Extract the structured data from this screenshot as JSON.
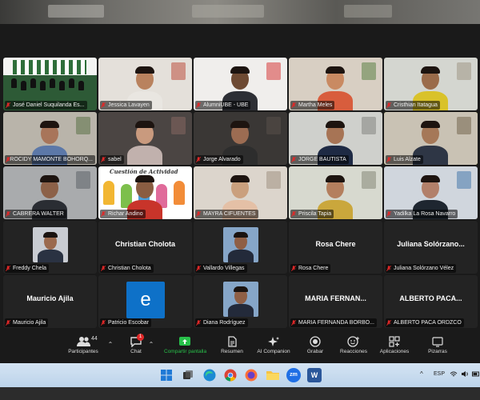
{
  "participants": [
    {
      "name": "José Daniel Suquilanda Es...",
      "type": "video",
      "active": false
    },
    {
      "name": "Jessica Lavayen",
      "type": "video",
      "active": false
    },
    {
      "name": "AlumniUBE - UBE",
      "type": "video",
      "active": false
    },
    {
      "name": "Martha Meles",
      "type": "video",
      "active": false
    },
    {
      "name": "Cristhian Itatagua",
      "type": "video",
      "active": false
    },
    {
      "name": "ROCIDY MAMONTE BOHORQ...",
      "type": "video",
      "active": false
    },
    {
      "name": "sabel",
      "type": "video",
      "active": false
    },
    {
      "name": "Jorge Alvarado",
      "type": "video",
      "active": false
    },
    {
      "name": "JORGE BAUTISTA",
      "type": "video",
      "active": false
    },
    {
      "name": "Luis Alzate",
      "type": "video",
      "active": true
    },
    {
      "name": "CABRERA WALTER",
      "type": "video",
      "active": false
    },
    {
      "name": "Richar Andino",
      "type": "video",
      "active": false
    },
    {
      "name": "MAYRA CIFUENTES",
      "type": "video",
      "active": false
    },
    {
      "name": "Priscila Tapia",
      "type": "video",
      "active": false
    },
    {
      "name": "Yadilka La Rosa Navarro",
      "type": "video",
      "active": false
    },
    {
      "name": "Freddy Chela",
      "type": "photo",
      "active": false
    },
    {
      "name": "Christian Cholota",
      "type": "name",
      "center": "Christian Cholota",
      "active": false
    },
    {
      "name": "Vallardo Villegas",
      "type": "photo",
      "active": false
    },
    {
      "name": "Rosa Chere",
      "type": "name",
      "center": "Rosa Chere",
      "active": false
    },
    {
      "name": "Juliana Solórzano Vélez",
      "type": "name",
      "center": "Juliana  Solórzano...",
      "active": false
    },
    {
      "name": "Mauricio Ajila",
      "type": "name",
      "center": "Mauricio Ajila",
      "active": false
    },
    {
      "name": "Patricio Escobar",
      "type": "initial",
      "initial": "e",
      "active": false
    },
    {
      "name": "Diana Rodríguez",
      "type": "photo",
      "active": false
    },
    {
      "name": "MARIA FERNANDA BORBO...",
      "type": "name",
      "center": "MARIA  FERNAN...",
      "active": false
    },
    {
      "name": "ALBERTO PACA ORDZCO",
      "type": "name",
      "center": "ALBERTO  PACA...",
      "active": false
    }
  ],
  "tile_overlay": {
    "cuestion_text": "Cuestión de Actividad"
  },
  "toolbar": {
    "participants_label": "Participantes",
    "participants_count": "44",
    "chat_label": "Chat",
    "chat_badge": "1",
    "share_label": "Compartir pantalla",
    "summary_label": "Resumen",
    "companion_label": "AI Companion",
    "record_label": "Grabar",
    "reactions_label": "Reacciones",
    "apps_label": "Aplicaciones",
    "boards_label": "Pizarras"
  },
  "taskbar": {
    "zoom_label": "zm",
    "word_label": "W",
    "language": "ESP",
    "chevron": "^"
  },
  "colors": {
    "accent_green": "#28c04a",
    "active_border": "#c7d61f",
    "muted_red": "#e02828",
    "initial_bg": "#0e71c8"
  }
}
